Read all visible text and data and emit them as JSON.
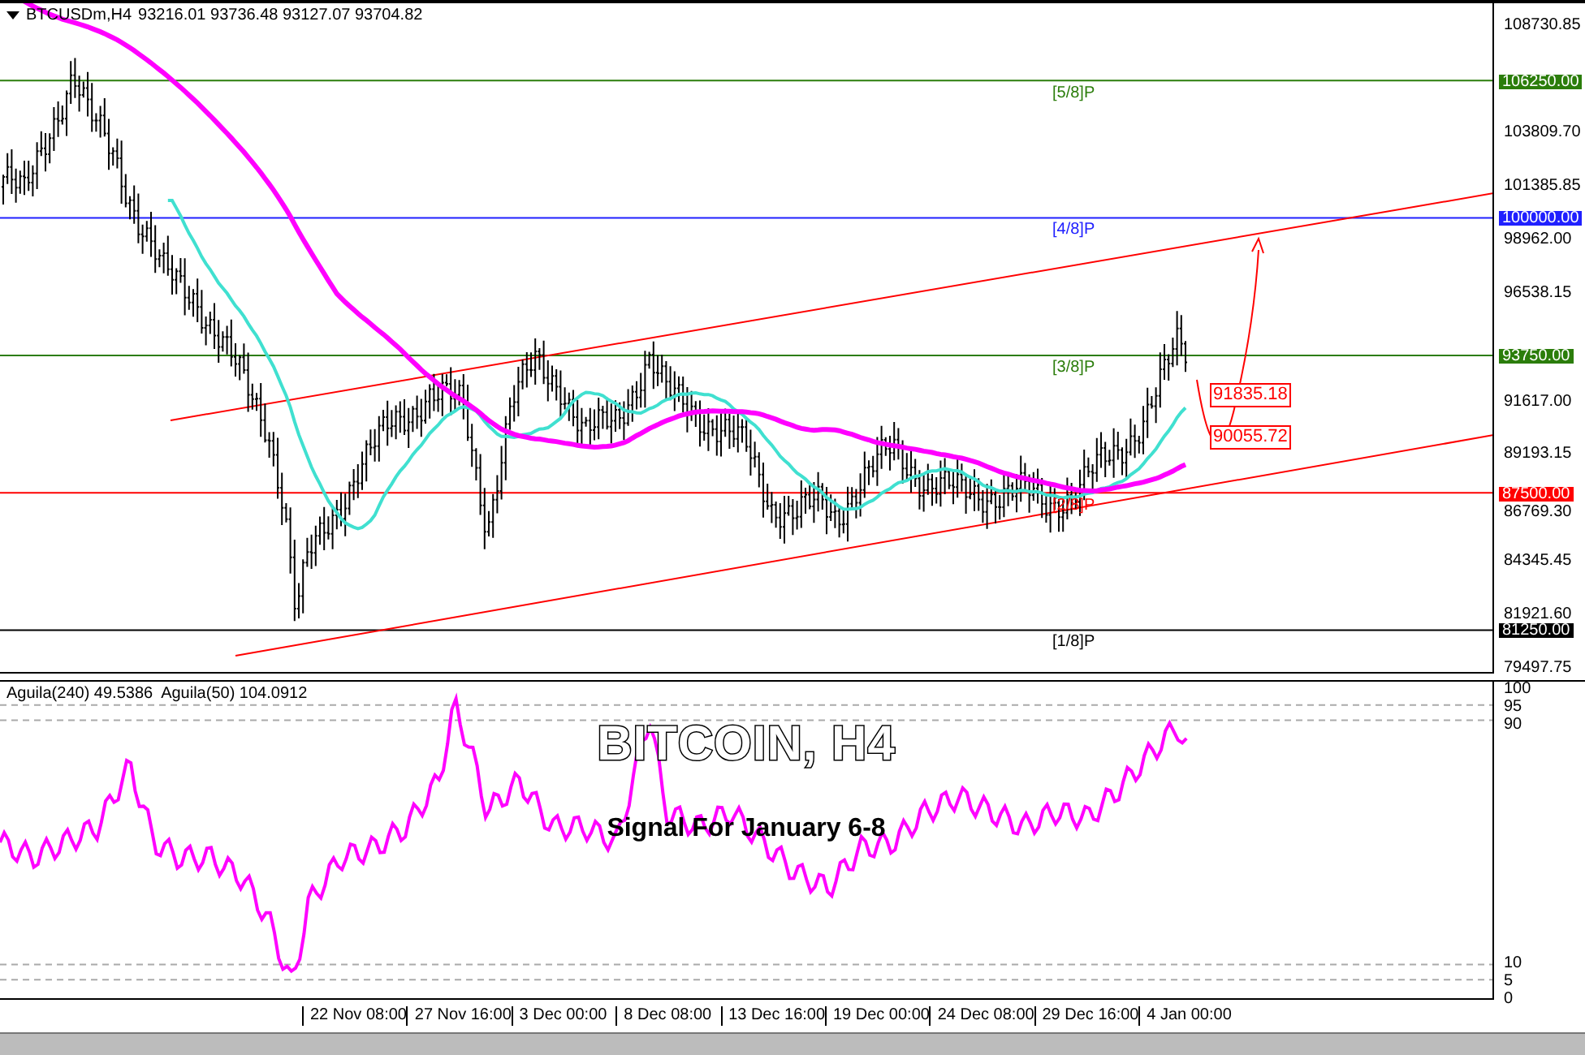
{
  "chart": {
    "symbol": "BTCUSDm,H4",
    "quote": "93216.01 93736.48 93127.07 93704.82",
    "title": "BITCOIN, H4",
    "subtitle": "Signal For January 6-8",
    "price_ticks": [
      "108730.85",
      "103809.70",
      "101385.85",
      "98962.00",
      "96538.15",
      "91617.00",
      "89193.15",
      "86769.30",
      "84345.45",
      "81921.60",
      "79497.75"
    ],
    "levels": [
      {
        "price": "106250.00",
        "label": "[5/8]P",
        "color": "#2b7d0b"
      },
      {
        "price": "100000.00",
        "label": "[4/8]P",
        "color": "#2020ff"
      },
      {
        "price": "93750.00",
        "label": "[3/8]P",
        "color": "#2b7d0b"
      },
      {
        "price": "87500.00",
        "label": "[2/8]P",
        "color": "#ff0000"
      },
      {
        "price": "81250.00",
        "label": "[1/8]P",
        "color": "#000000"
      }
    ],
    "annotations": [
      "91835.18",
      "90055.72"
    ]
  },
  "indicator": {
    "legend": "Aguila(240) 49.5386  Aguila(50) 104.0912",
    "ticks": [
      "100",
      "95",
      "90",
      "10",
      "5",
      "0"
    ]
  },
  "time_axis": [
    "22 Nov 08:00",
    "27 Nov 16:00",
    "3 Dec 00:00",
    "8 Dec 08:00",
    "13 Dec 16:00",
    "19 Dec 00:00",
    "24 Dec 08:00",
    "29 Dec 16:00",
    "4 Jan 00:00"
  ]
}
